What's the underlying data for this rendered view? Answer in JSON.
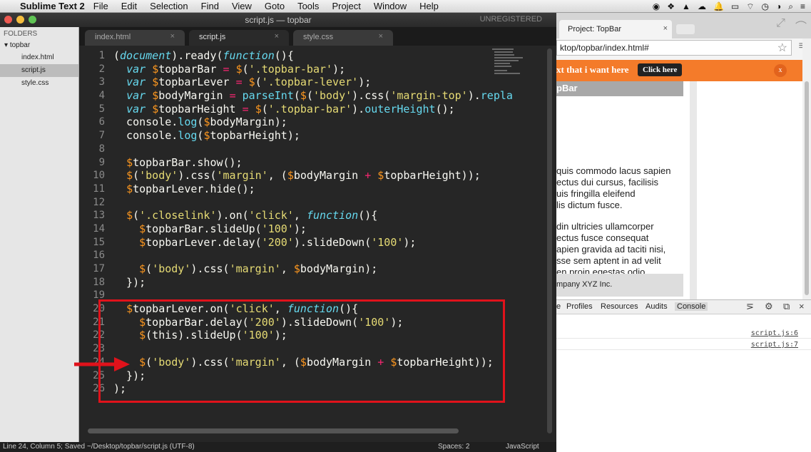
{
  "menubar": {
    "app": "Sublime Text 2",
    "items": [
      "File",
      "Edit",
      "Selection",
      "Find",
      "View",
      "Goto",
      "Tools",
      "Project",
      "Window",
      "Help"
    ]
  },
  "sublime": {
    "window_title": "script.js — topbar",
    "unregistered": "UNREGISTERED",
    "sidebar": {
      "header": "FOLDERS",
      "folder": "topbar",
      "files": [
        "index.html",
        "script.js",
        "style.css"
      ],
      "active_file": "script.js"
    },
    "tabs": [
      {
        "label": "index.html",
        "close": "×"
      },
      {
        "label": "script.js",
        "close": "×"
      },
      {
        "label": "style.css",
        "close": "×"
      }
    ],
    "active_tab": "script.js",
    "line_numbers": [
      "1",
      "2",
      "3",
      "4",
      "5",
      "6",
      "7",
      "8",
      "9",
      "10",
      "11",
      "12",
      "13",
      "14",
      "15",
      "16",
      "17",
      "18",
      "19",
      "20",
      "21",
      "22",
      "23",
      "24",
      "25",
      "26"
    ],
    "status": {
      "left": "Line 24, Column 5; Saved ~/Desktop/topbar/script.js (UTF-8)",
      "spaces": "Spaces: 2",
      "syntax": "JavaScript"
    }
  },
  "browser": {
    "tab_title": "Project: TopBar",
    "tab_close": "×",
    "url": "ktop/topbar/index.html#",
    "topbar_text": "xt that i want here",
    "topbar_button": "Click here",
    "topbar_close": "x",
    "page_header": "pBar",
    "paragraph1": [
      "quis commodo lacus sapien",
      "ectus dui cursus, facilisis",
      "uis fringilla eleifend",
      "lis dictum fusce."
    ],
    "paragraph2": [
      "din ultricies ullamcorper",
      "ectus fusce consequat",
      "apien gravida ad taciti nisi,",
      "sse sem aptent in ad velit",
      "en proin egestas odio."
    ],
    "footer": "mpany XYZ Inc.",
    "devtools_tabs": [
      "e",
      "Profiles",
      "Resources",
      "Audits",
      "Console"
    ],
    "devtools_active": "Console",
    "console_links": [
      "script.js:6",
      "script.js:7"
    ]
  },
  "colors": {
    "editor_bg": "#262626",
    "keyword": "#66d9ef",
    "string": "#e6db74",
    "variable": "#fd971f",
    "operator": "#f92672",
    "highlight_box": "#e0121b",
    "topbar_orange": "#f47b2a"
  }
}
